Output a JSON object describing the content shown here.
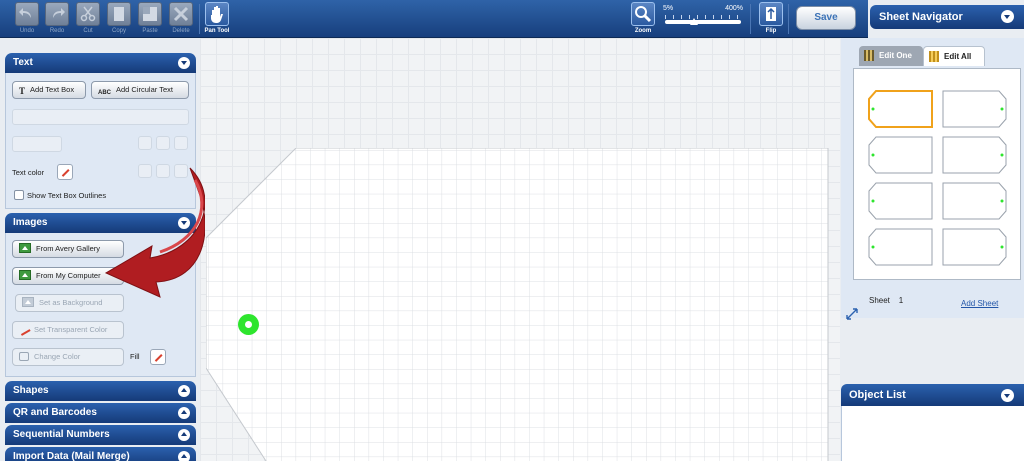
{
  "toolbar": {
    "undo": "Undo",
    "redo": "Redo",
    "cut": "Cut",
    "copy": "Copy",
    "paste": "Paste",
    "delete": "Delete",
    "pan_tool": "Pan Tool",
    "zoom": "Zoom",
    "zoom_min": "5%",
    "zoom_max": "400%",
    "zoom_level": 0.35,
    "flip": "Flip",
    "save": "Save"
  },
  "left_panel": {
    "text_section": {
      "title": "Text",
      "add_text_box": "Add Text Box",
      "add_text_box_glyph": "T",
      "add_circular_text": "Add Circular Text",
      "add_circular_text_glyph": "ABC",
      "text_color_label": "Text color",
      "show_outlines_label": "Show Text Box Outlines"
    },
    "images_section": {
      "title": "Images",
      "from_gallery": "From Avery Gallery",
      "from_computer": "From My Computer",
      "set_background": "Set as Background",
      "set_transparent": "Set Transparent Color",
      "change_color": "Change Color",
      "fill_label": "Fill"
    },
    "collapsed_sections": [
      "Shapes",
      "QR and Barcodes",
      "Sequential Numbers",
      "Import Data (Mail Merge)"
    ]
  },
  "sheet_navigator": {
    "title": "Sheet Navigator",
    "tab_edit_one": "Edit One",
    "tab_edit_all": "Edit All",
    "sheet_label": "Sheet",
    "sheet_number": "1",
    "add_sheet": "Add Sheet",
    "thumbnails": 8,
    "selected_thumbnail": 1
  },
  "object_list": {
    "title": "Object List"
  },
  "colors": {
    "toolbar_blue": "#1f4c8f",
    "annotation_arrow": "#b01d21",
    "highlight_dot": "#2ee52e",
    "selected_thumb": "#f0a21b"
  }
}
